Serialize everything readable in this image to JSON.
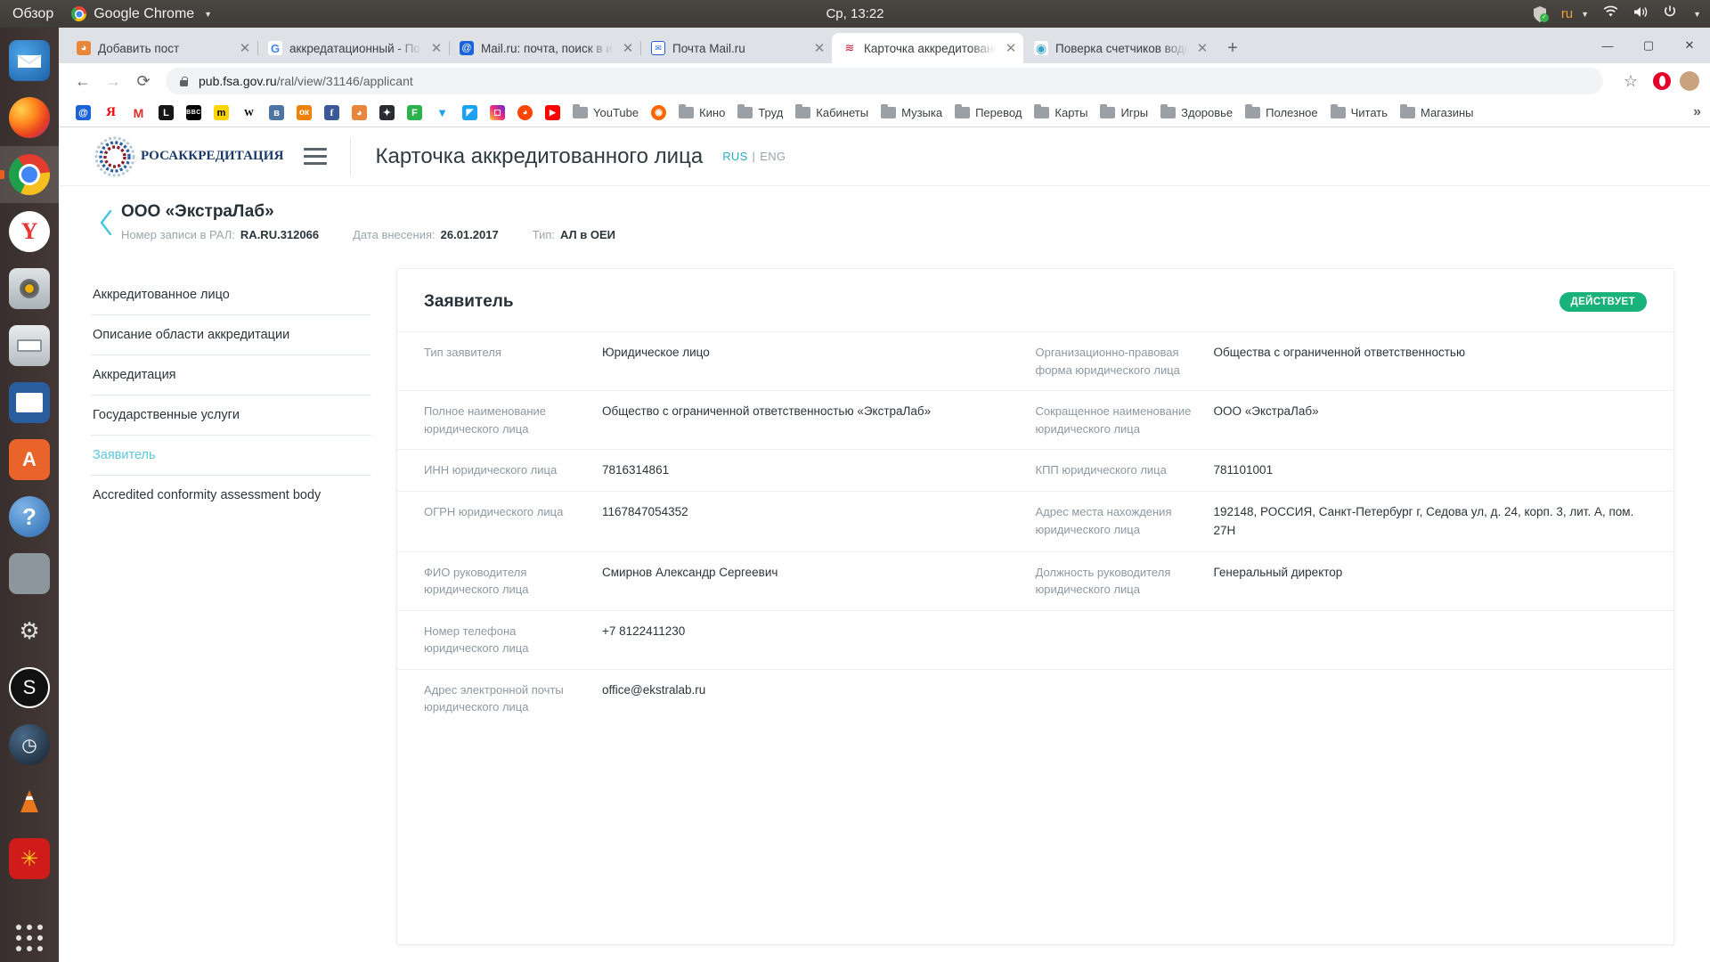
{
  "desktop": {
    "overview_label": "Обзор",
    "app_menu_label": "Google Chrome",
    "clock": "Ср, 13:22",
    "lang_indicator": "ru",
    "tray_icons": [
      "shield-ok-icon",
      "keyboard-lang-indicator",
      "wifi-icon",
      "volume-icon",
      "power-icon"
    ],
    "launcher_items": [
      {
        "name": "thunderbird",
        "glyph": "✉"
      },
      {
        "name": "firefox",
        "glyph": "🦊"
      },
      {
        "name": "google-chrome",
        "glyph": "◉",
        "active": true
      },
      {
        "name": "yandex-browser",
        "glyph": "Y"
      },
      {
        "name": "rhythmbox",
        "glyph": "◎"
      },
      {
        "name": "files",
        "glyph": "🗄"
      },
      {
        "name": "libreoffice-impress",
        "glyph": "▤"
      },
      {
        "name": "ubuntu-software",
        "glyph": "A"
      },
      {
        "name": "help",
        "glyph": "?"
      },
      {
        "name": "calculator",
        "glyph": "="
      },
      {
        "name": "system-tools",
        "glyph": "🔧"
      },
      {
        "name": "obs-studio",
        "glyph": "◐"
      },
      {
        "name": "steam",
        "glyph": "◑"
      },
      {
        "name": "vlc",
        "glyph": "▲"
      },
      {
        "name": "archive-manager",
        "glyph": "◈"
      },
      {
        "name": "show-applications",
        "glyph": "⠿"
      }
    ]
  },
  "browser": {
    "tabs": [
      {
        "label": "Добавить пост",
        "favicon": "wordpress-icon",
        "fav_bg": "#e8873c",
        "fav_text": "",
        "active": false
      },
      {
        "label": "аккредатационный - Поиск",
        "favicon": "google-icon",
        "fav_bg": "#ffffff",
        "fav_text": "G",
        "active": false
      },
      {
        "label": "Mail.ru: почта, поиск в интернете",
        "favicon": "mailru-icon",
        "fav_bg": "#1b63d8",
        "fav_text": "@",
        "active": false
      },
      {
        "label": "Почта Mail.ru",
        "favicon": "mailru-mail-icon",
        "fav_bg": "#1b63d8",
        "fav_text": "✉",
        "active": false
      },
      {
        "label": "Карточка аккредитованного лица",
        "favicon": "fsa-icon",
        "fav_bg": "#ffffff",
        "fav_text": "≋",
        "active": true
      },
      {
        "label": "Поверка счетчиков воды",
        "favicon": "spiral-icon",
        "fav_bg": "#ffffff",
        "fav_text": "◉",
        "active": false
      }
    ],
    "new_tab_label": "+",
    "window_buttons": [
      "minimize",
      "maximize",
      "close"
    ],
    "nav": {
      "back": "←",
      "forward": "→",
      "reload": "⟳"
    },
    "omnibox": {
      "lock_icon": "lock-icon",
      "host": "pub.fsa.gov.ru",
      "path": "/ral/view/31146/applicant",
      "star_icon": "bookmark-star-icon",
      "extension_icon": "opera-extension-icon",
      "profile_icon": "profile-avatar-icon"
    },
    "bookmarks": [
      {
        "label": "",
        "icon": "mailru-icon",
        "bg": "#1b63d8",
        "text": "@"
      },
      {
        "label": "",
        "icon": "yandex-icon",
        "bg": "#ffffff",
        "text": "Я",
        "fg": "#ff0000"
      },
      {
        "label": "",
        "icon": "gmail-icon",
        "bg": "#ffffff",
        "text": "M",
        "fg": "#d93025"
      },
      {
        "label": "",
        "icon": "livejournal-icon",
        "bg": "#1a1a1a",
        "text": "L"
      },
      {
        "label": "",
        "icon": "bbc-icon",
        "bg": "#000000",
        "text": "BBC"
      },
      {
        "label": "",
        "icon": "metrika-icon",
        "bg": "#ffd400",
        "text": "m",
        "fg": "#000"
      },
      {
        "label": "",
        "icon": "wikipedia-icon",
        "bg": "#ffffff",
        "text": "W",
        "fg": "#000"
      },
      {
        "label": "",
        "icon": "vk-icon",
        "bg": "#4c75a3",
        "text": "B"
      },
      {
        "label": "",
        "icon": "odnoklassniki-icon",
        "bg": "#ee8208",
        "text": "ok"
      },
      {
        "label": "",
        "icon": "facebook-icon",
        "bg": "#3b5998",
        "text": "f"
      },
      {
        "label": "",
        "icon": "wordpress-icon",
        "bg": "#e8873c",
        "text": "◕"
      },
      {
        "label": "",
        "icon": "blogger-icon",
        "bg": "#2b2b33",
        "text": "✦"
      },
      {
        "label": "",
        "icon": "feedly-icon",
        "bg": "#2bb24c",
        "text": "F"
      },
      {
        "label": "",
        "icon": "twitter-icon",
        "bg": "#ffffff",
        "text": "🐦",
        "fg": "#1da1f2"
      },
      {
        "label": "",
        "icon": "pocket-icon",
        "bg": "#1da1f2",
        "text": "◣"
      },
      {
        "label": "",
        "icon": "instagram-icon",
        "bg": "#c13584",
        "text": "◻"
      },
      {
        "label": "",
        "icon": "reddit-icon",
        "bg": "#ff4500",
        "text": "◕"
      },
      {
        "label": "",
        "icon": "youtube-play-icon",
        "bg": "#ff0000",
        "text": "▶"
      },
      {
        "label": "YouTube",
        "icon": "folder-icon"
      },
      {
        "label": "",
        "icon": "kinopoisk-icon",
        "bg": "#f60",
        "text": "◉"
      },
      {
        "label": "Кино",
        "icon": "folder-icon"
      },
      {
        "label": "Труд",
        "icon": "folder-icon"
      },
      {
        "label": "Кабинеты",
        "icon": "folder-icon"
      },
      {
        "label": "Музыка",
        "icon": "folder-icon"
      },
      {
        "label": "Перевод",
        "icon": "folder-icon"
      },
      {
        "label": "Карты",
        "icon": "folder-icon"
      },
      {
        "label": "Игры",
        "icon": "folder-icon"
      },
      {
        "label": "Здоровье",
        "icon": "folder-icon"
      },
      {
        "label": "Полезное",
        "icon": "folder-icon"
      },
      {
        "label": "Читать",
        "icon": "folder-icon"
      },
      {
        "label": "Магазины",
        "icon": "folder-icon"
      }
    ],
    "bookmarks_overflow": "»"
  },
  "site": {
    "logo_text": "РОСАККРЕДИТАЦИЯ",
    "page_title": "Карточка аккредитованного лица",
    "lang": {
      "current": "RUS",
      "separator": "|",
      "other": "ENG"
    },
    "record": {
      "name": "ООО «ЭкстраЛаб»",
      "meta": [
        {
          "key": "Номер записи в РАЛ:",
          "value": "RA.RU.312066"
        },
        {
          "key": "Дата внесения:",
          "value": "26.01.2017"
        },
        {
          "key": "Тип:",
          "value": "АЛ в ОЕИ"
        }
      ]
    },
    "nav_items": [
      {
        "label": "Аккредитованное лицо",
        "active": false
      },
      {
        "label": "Описание области аккредитации",
        "active": false
      },
      {
        "label": "Аккредитация",
        "active": false
      },
      {
        "label": "Государственные услуги",
        "active": false
      },
      {
        "label": "Заявитель",
        "active": true
      },
      {
        "label": "Accredited conformity assessment body",
        "active": false
      }
    ],
    "card": {
      "title": "Заявитель",
      "status": "ДЕЙСТВУЕТ",
      "status_color": "#19b27a",
      "rows": [
        {
          "left": {
            "label": "Тип заявителя",
            "value": "Юридическое лицо"
          },
          "right": {
            "label": "Организационно-правовая форма юридического лица",
            "value": "Общества с ограниченной ответственностью"
          }
        },
        {
          "left": {
            "label": "Полное наименование юридического лица",
            "value": "Общество с ограниченной ответственностью «ЭкстраЛаб»"
          },
          "right": {
            "label": "Сокращенное наименование юридического лица",
            "value": "ООО «ЭкстраЛаб»"
          }
        },
        {
          "left": {
            "label": "ИНН юридического лица",
            "value": "7816314861"
          },
          "right": {
            "label": "КПП юридического лица",
            "value": "781101001"
          }
        },
        {
          "left": {
            "label": "ОГРН юридического лица",
            "value": "1167847054352"
          },
          "right": {
            "label": "Адрес места нахождения юридического лица",
            "value": "192148, РОССИЯ, Санкт-Петербург г, Седова ул, д. 24, корп. 3, лит. А, пом. 27Н"
          }
        },
        {
          "left": {
            "label": "ФИО руководителя юридического лица",
            "value": "Смирнов Александр Сергеевич"
          },
          "right": {
            "label": "Должность руководителя юридического лица",
            "value": "Генеральный директор"
          }
        },
        {
          "left": {
            "label": "Номер телефона юридического лица",
            "value": "+7 8122411230"
          },
          "right": {
            "label": "",
            "value": ""
          }
        },
        {
          "left": {
            "label": "Адрес электронной почты юридического лица",
            "value": "office@ekstralab.ru"
          },
          "right": {
            "label": "",
            "value": ""
          }
        }
      ]
    }
  }
}
